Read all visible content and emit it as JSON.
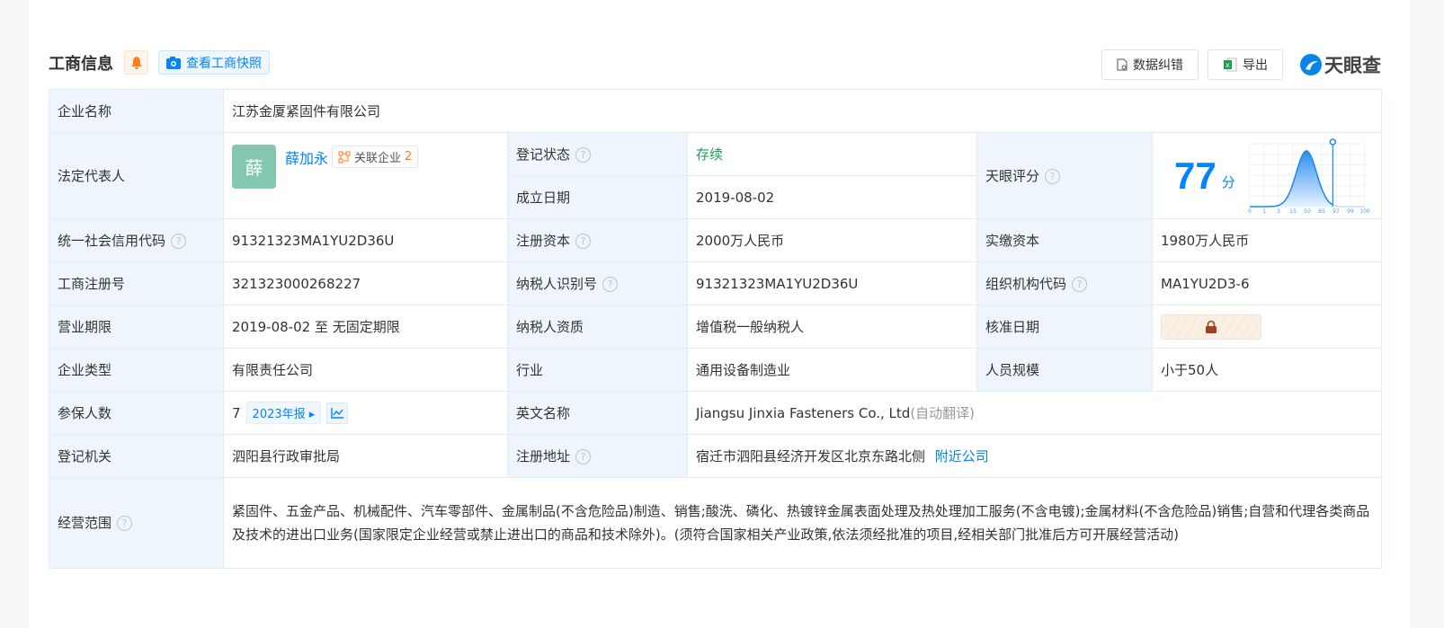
{
  "header": {
    "title": "工商信息",
    "snapshot_label": "查看工商快照",
    "correction_label": "数据纠错",
    "export_label": "导出",
    "brand": "天眼查"
  },
  "company_name": {
    "label": "企业名称",
    "value": "江苏金厦紧固件有限公司"
  },
  "legal_rep": {
    "label": "法定代表人",
    "avatar_char": "薛",
    "name": "薛加永",
    "related_label": "关联企业",
    "related_count": "2"
  },
  "reg_status": {
    "label": "登记状态",
    "value": "存续"
  },
  "established": {
    "label": "成立日期",
    "value": "2019-08-02"
  },
  "score": {
    "label": "天眼评分",
    "value": "77",
    "unit": "分",
    "ticks": [
      "0",
      "1",
      "3",
      "15",
      "50",
      "85",
      "97",
      "99",
      "100"
    ],
    "accent": "#0084ff"
  },
  "rows": [
    [
      {
        "label": "统一社会信用代码",
        "q": true,
        "value": "91321323MA1YU2D36U"
      },
      {
        "label": "注册资本",
        "q": true,
        "value": "2000万人民币"
      },
      {
        "label": "实缴资本",
        "value": "1980万人民币"
      }
    ],
    [
      {
        "label": "工商注册号",
        "value": "321323000268227"
      },
      {
        "label": "纳税人识别号",
        "q": true,
        "value": "91321323MA1YU2D36U"
      },
      {
        "label": "组织机构代码",
        "q": true,
        "value": "MA1YU2D3-6"
      }
    ],
    [
      {
        "label": "营业期限",
        "value": "2019-08-02 至 无固定期限"
      },
      {
        "label": "纳税人资质",
        "value": "增值税一般纳税人"
      },
      {
        "label": "核准日期"
      }
    ],
    [
      {
        "label": "企业类型",
        "value": "有限责任公司"
      },
      {
        "label": "行业",
        "value": "通用设备制造业"
      },
      {
        "label": "人员规模",
        "value": "小于50人"
      }
    ]
  ],
  "insured": {
    "label": "参保人数",
    "value": "7",
    "report": "2023年报"
  },
  "english_name": {
    "label": "英文名称",
    "value": "Jiangsu Jinxia Fasteners Co., Ltd",
    "note": "(自动翻译)"
  },
  "authority": {
    "label": "登记机关",
    "value": "泗阳县行政审批局"
  },
  "address": {
    "label": "注册地址",
    "value": "宿迁市泗阳县经济开发区北京东路北侧",
    "nearby": "附近公司"
  },
  "scope": {
    "label": "经营范围",
    "value": "紧固件、五金产品、机械配件、汽车零部件、金属制品(不含危险品)制造、销售;酸洗、磷化、热镀锌金属表面处理及热处理加工服务(不含电镀);金属材料(不含危险品)销售;自营和代理各类商品及技术的进出口业务(国家限定企业经营或禁止进出口的商品和技术除外)。(须符合国家相关产业政策,依法须经批准的项目,经相关部门批准后方可开展经营活动)"
  }
}
